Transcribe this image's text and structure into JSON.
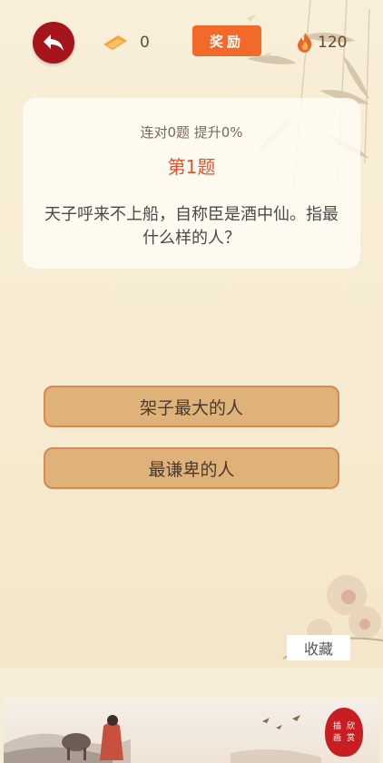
{
  "header": {
    "ticket_count": "0",
    "reward_label": "奖励",
    "fire_count": "120"
  },
  "question": {
    "progress": "连对0题 提升0%",
    "number": "第1题",
    "text": "天子呼来不上船，自称臣是酒中仙。指最什么样的人？"
  },
  "answers": [
    {
      "label": "架子最大的人"
    },
    {
      "label": "最谦卑的人"
    }
  ],
  "favorite_label": "收藏",
  "banner": {
    "stamp_text": [
      "插",
      "画",
      "欣",
      "赏"
    ]
  },
  "colors": {
    "back_button": "#a5151b",
    "reward_button": "#f26a2a",
    "question_number": "#e1522a",
    "answer_fill": "#deb279",
    "answer_border": "#d9884f"
  },
  "icons": {
    "back": "back-arrow-icon",
    "ticket": "ticket-icon",
    "fire": "fire-icon"
  }
}
